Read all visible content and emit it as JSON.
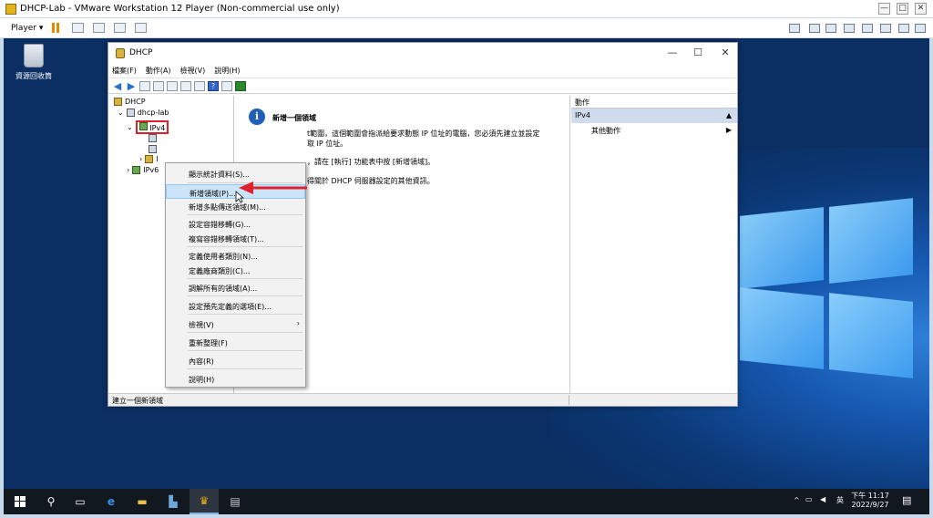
{
  "vmware": {
    "window_title": "DHCP-Lab - VMware Workstation 12 Player (Non-commercial use only)",
    "player_menu": "Player ▾",
    "min": "—",
    "max": "□",
    "close": "✕"
  },
  "desktop": {
    "recycle_bin_label": "資源回收筒"
  },
  "dhcp_window": {
    "title": "DHCP",
    "min": "—",
    "max": "☐",
    "close": "✕",
    "menu": [
      "檔案(F)",
      "動作(A)",
      "檢視(V)",
      "說明(H)"
    ]
  },
  "tree": {
    "root": "DHCP",
    "server": "dhcp-lab",
    "ipv4": "IPv4",
    "ipv6": "IPv6",
    "collapsed_stub": "I"
  },
  "center": {
    "heading": "新增一個領域",
    "line1": "t範圍，這個範圍會指派給要求動態 IP 位址的電腦，您必須先建立並設定",
    "line2": "取 IP 位址。",
    "line3": "，請在 [執行] 功能表中按 [新增領域]。",
    "line4": "得關於 DHCP 伺服器設定的其他資訊。"
  },
  "actions": {
    "header": "動作",
    "section": "IPv4",
    "section_arrow": "▲",
    "item": "其他動作",
    "item_arrow": "▶"
  },
  "status_bar": {
    "text": "建立一個新領域"
  },
  "context_menu": {
    "items": [
      "顯示統計資料(S)...",
      "新增領域(P)...",
      "新增多點傳送領域(M)...",
      "設定容錯移轉(G)...",
      "複寫容錯移轉領域(T)...",
      "定義使用者類別(N)...",
      "定義廠商類別(C)...",
      "調解所有的領域(A)...",
      "設定預先定義的選項(E)...",
      "檢視(V)",
      "重新整理(F)",
      "內容(R)",
      "說明(H)"
    ],
    "submenu_arrow": "›"
  },
  "taskbar": {
    "time": "下午 11:17",
    "date": "2022/9/27",
    "ime": "英",
    "tray_chevron": "^"
  },
  "colors": {
    "annotation_red": "#e0202a",
    "hover_blue": "#cce4f7",
    "desktop_blue": "#0b2f63"
  }
}
